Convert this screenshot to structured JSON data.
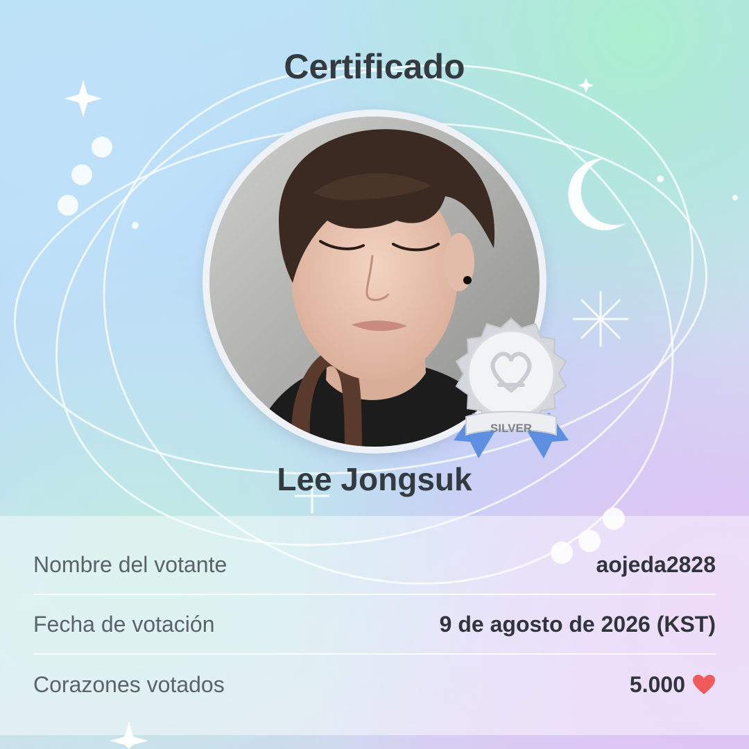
{
  "certificate": {
    "title": "Certificado",
    "artist_name": "Lee Jongsuk",
    "photo_description_icon": "artist-photo",
    "badge": {
      "label": "SILVER",
      "icon": "silver-medal-icon"
    },
    "details": [
      {
        "label": "Nombre del votante",
        "value": "aojeda2828"
      },
      {
        "label": "Fecha de votación",
        "value": "9 de agosto de 2026 (KST)"
      },
      {
        "label": "Corazones votados",
        "value": "5.000",
        "icon": "heart-icon"
      }
    ]
  },
  "colors": {
    "text_dark": "#333a40",
    "heart": "#f05a5a",
    "badge_blue": "#5d8fe0"
  }
}
